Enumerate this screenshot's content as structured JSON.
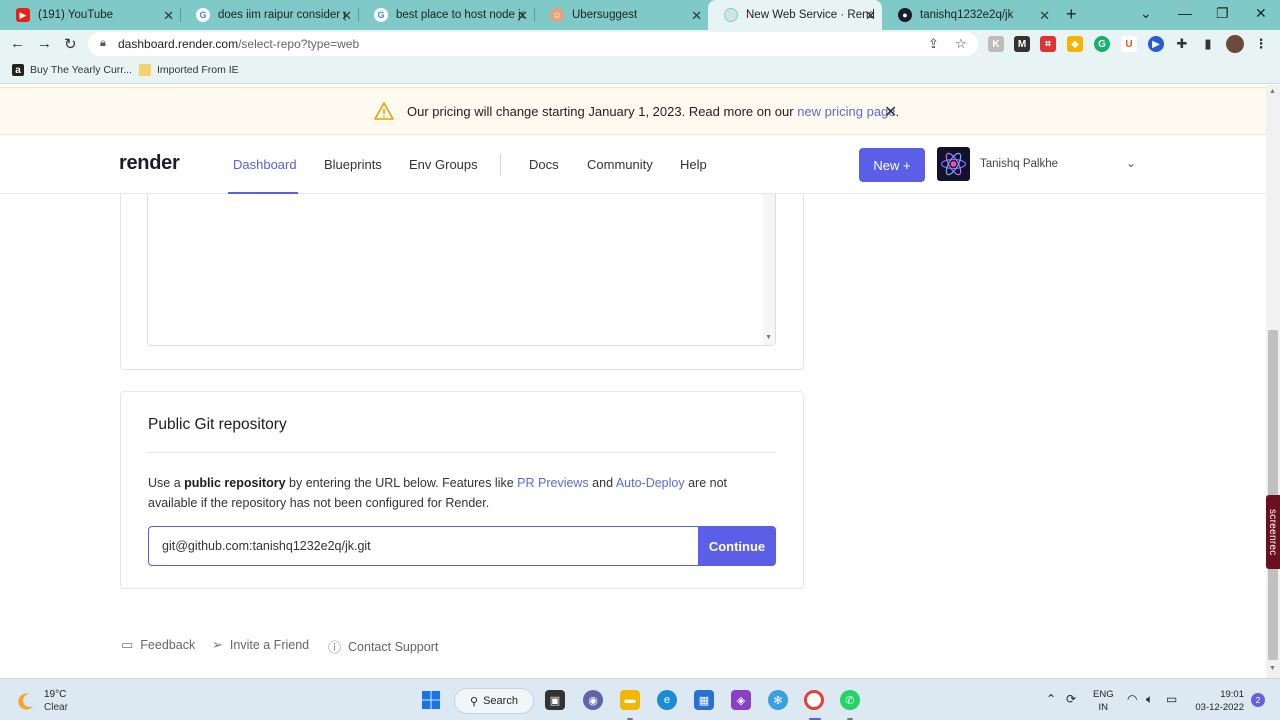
{
  "browser": {
    "tabs": [
      {
        "title": "(191) YouTube",
        "icon": "youtube-icon"
      },
      {
        "title": "does iim raipur consider gr",
        "icon": "google-icon"
      },
      {
        "title": "best place to host node js a",
        "icon": "google-icon"
      },
      {
        "title": "Ubersuggest",
        "icon": "ubersuggest-icon"
      },
      {
        "title": "New Web Service · Render",
        "icon": "render-icon"
      },
      {
        "title": "tanishq1232e2q/jk",
        "icon": "github-icon"
      }
    ],
    "url_host": "dashboard.render.com",
    "url_path": "/select-repo?type=web",
    "bookmarks": [
      {
        "label": "Buy The Yearly Curr...",
        "icon": "amazon-icon"
      },
      {
        "label": "Imported From IE",
        "icon": "folder-icon"
      }
    ]
  },
  "banner": {
    "text": "Our pricing will change starting January 1, 2023. Read more on our ",
    "link": "new pricing page",
    "suffix": "."
  },
  "header": {
    "logo": "render",
    "nav": [
      "Dashboard",
      "Blueprints",
      "Env Groups",
      "Docs",
      "Community",
      "Help"
    ],
    "new_button": "New +",
    "username": "Tanishq Palkhe"
  },
  "public_repo": {
    "title": "Public Git repository",
    "desc_1": "Use a ",
    "desc_bold": "public repository",
    "desc_2": " by entering the URL below. Features like ",
    "link_1": "PR Previews",
    "desc_3": " and ",
    "link_2": "Auto-Deploy",
    "desc_4": " are not available if the repository has not been configured for Render.",
    "input_value": "git@github.com:tanishq1232e2q/jk.git",
    "continue_label": "Continue"
  },
  "footer": {
    "feedback": "Feedback",
    "invite": "Invite a Friend",
    "support": "Contact Support"
  },
  "screenrec_label": "screenrec",
  "taskbar": {
    "temperature": "19°C",
    "condition": "Clear",
    "search_label": "Search",
    "lang_1": "ENG",
    "lang_2": "IN",
    "time": "19:01",
    "date": "03-12-2022",
    "notifications": "2"
  },
  "colors": {
    "accent": "#5b5ee6",
    "tabstrip": "#7fcac9",
    "banner_bg": "#fffaf0"
  }
}
